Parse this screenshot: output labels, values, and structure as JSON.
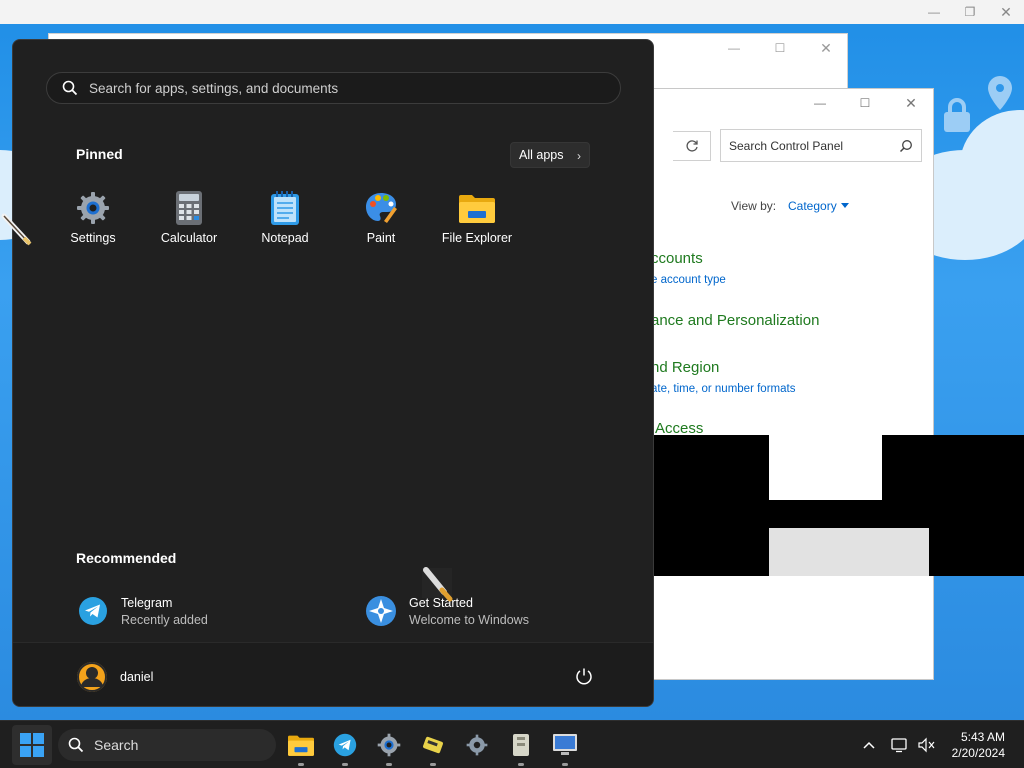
{
  "background_windows": {
    "top_window": {
      "caption_buttons": [
        "minimize",
        "restore",
        "close"
      ]
    },
    "mid_window": {
      "caption_buttons": [
        "minimize",
        "maximize",
        "close"
      ]
    }
  },
  "control_panel": {
    "caption_buttons": [
      "minimize",
      "maximize",
      "close"
    ],
    "search_placeholder": "Search Control Panel",
    "view_by_label": "View by:",
    "view_by_value": "Category",
    "items": [
      {
        "heading": "ccounts",
        "link": "e account type"
      },
      {
        "heading": "ance and Personalization",
        "link": ""
      },
      {
        "heading": "nd Region",
        "link": "ate, time, or number formats"
      },
      {
        "heading": "Access",
        "link": ""
      }
    ]
  },
  "start_menu": {
    "search_placeholder": "Search for apps, settings, and documents",
    "pinned_title": "Pinned",
    "all_apps_label": "All apps",
    "pinned_apps": [
      {
        "label": "Settings",
        "icon": "settings-gear-icon"
      },
      {
        "label": "Calculator",
        "icon": "calculator-icon"
      },
      {
        "label": "Notepad",
        "icon": "notepad-icon"
      },
      {
        "label": "Paint",
        "icon": "paint-palette-icon"
      },
      {
        "label": "File Explorer",
        "icon": "folder-icon"
      }
    ],
    "recommended_title": "Recommended",
    "recommended": [
      {
        "name": "Telegram",
        "sub": "Recently added",
        "icon": "telegram-icon"
      },
      {
        "name": "Get Started",
        "sub": "Welcome to Windows",
        "icon": "get-started-icon"
      }
    ],
    "user_name": "daniel"
  },
  "taskbar": {
    "search_label": "Search",
    "pinned": [
      "file-explorer",
      "telegram",
      "settings",
      "app-icon",
      "settings",
      "archive",
      "monitor"
    ],
    "clock_time": "5:43 AM",
    "clock_date": "2/20/2024"
  },
  "colors": {
    "accent": "#0078d4",
    "cp_heading_green": "#1f7a1f",
    "cp_link_blue": "#0066cc",
    "start_bg": "#202020"
  }
}
